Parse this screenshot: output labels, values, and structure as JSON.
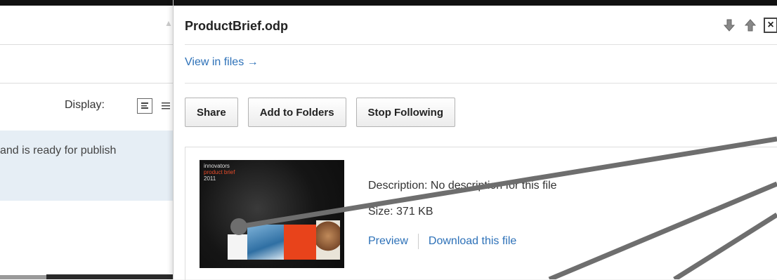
{
  "background": {
    "display_label": "Display:",
    "highlight_text": "and is ready for publish"
  },
  "panel": {
    "title": "ProductBrief.odp",
    "view_in_files": "View in files →",
    "buttons": {
      "share": "Share",
      "add_to_folders": "Add to Folders",
      "stop_following": "Stop Following"
    },
    "thumbnail_lines": [
      "innovators",
      "product brief",
      "2011"
    ],
    "description": "Description: No description for this file",
    "size": "Size: 371 KB",
    "preview": "Preview",
    "download": "Download this file",
    "icons": {
      "move_down": "arrow-down-icon",
      "move_up": "arrow-up-icon",
      "close": "close-icon"
    }
  },
  "colors": {
    "link": "#2d71b8",
    "top_bar": "#111111",
    "highlight_row": "#e6eef5",
    "annotation_line": "#6e6e6e"
  }
}
